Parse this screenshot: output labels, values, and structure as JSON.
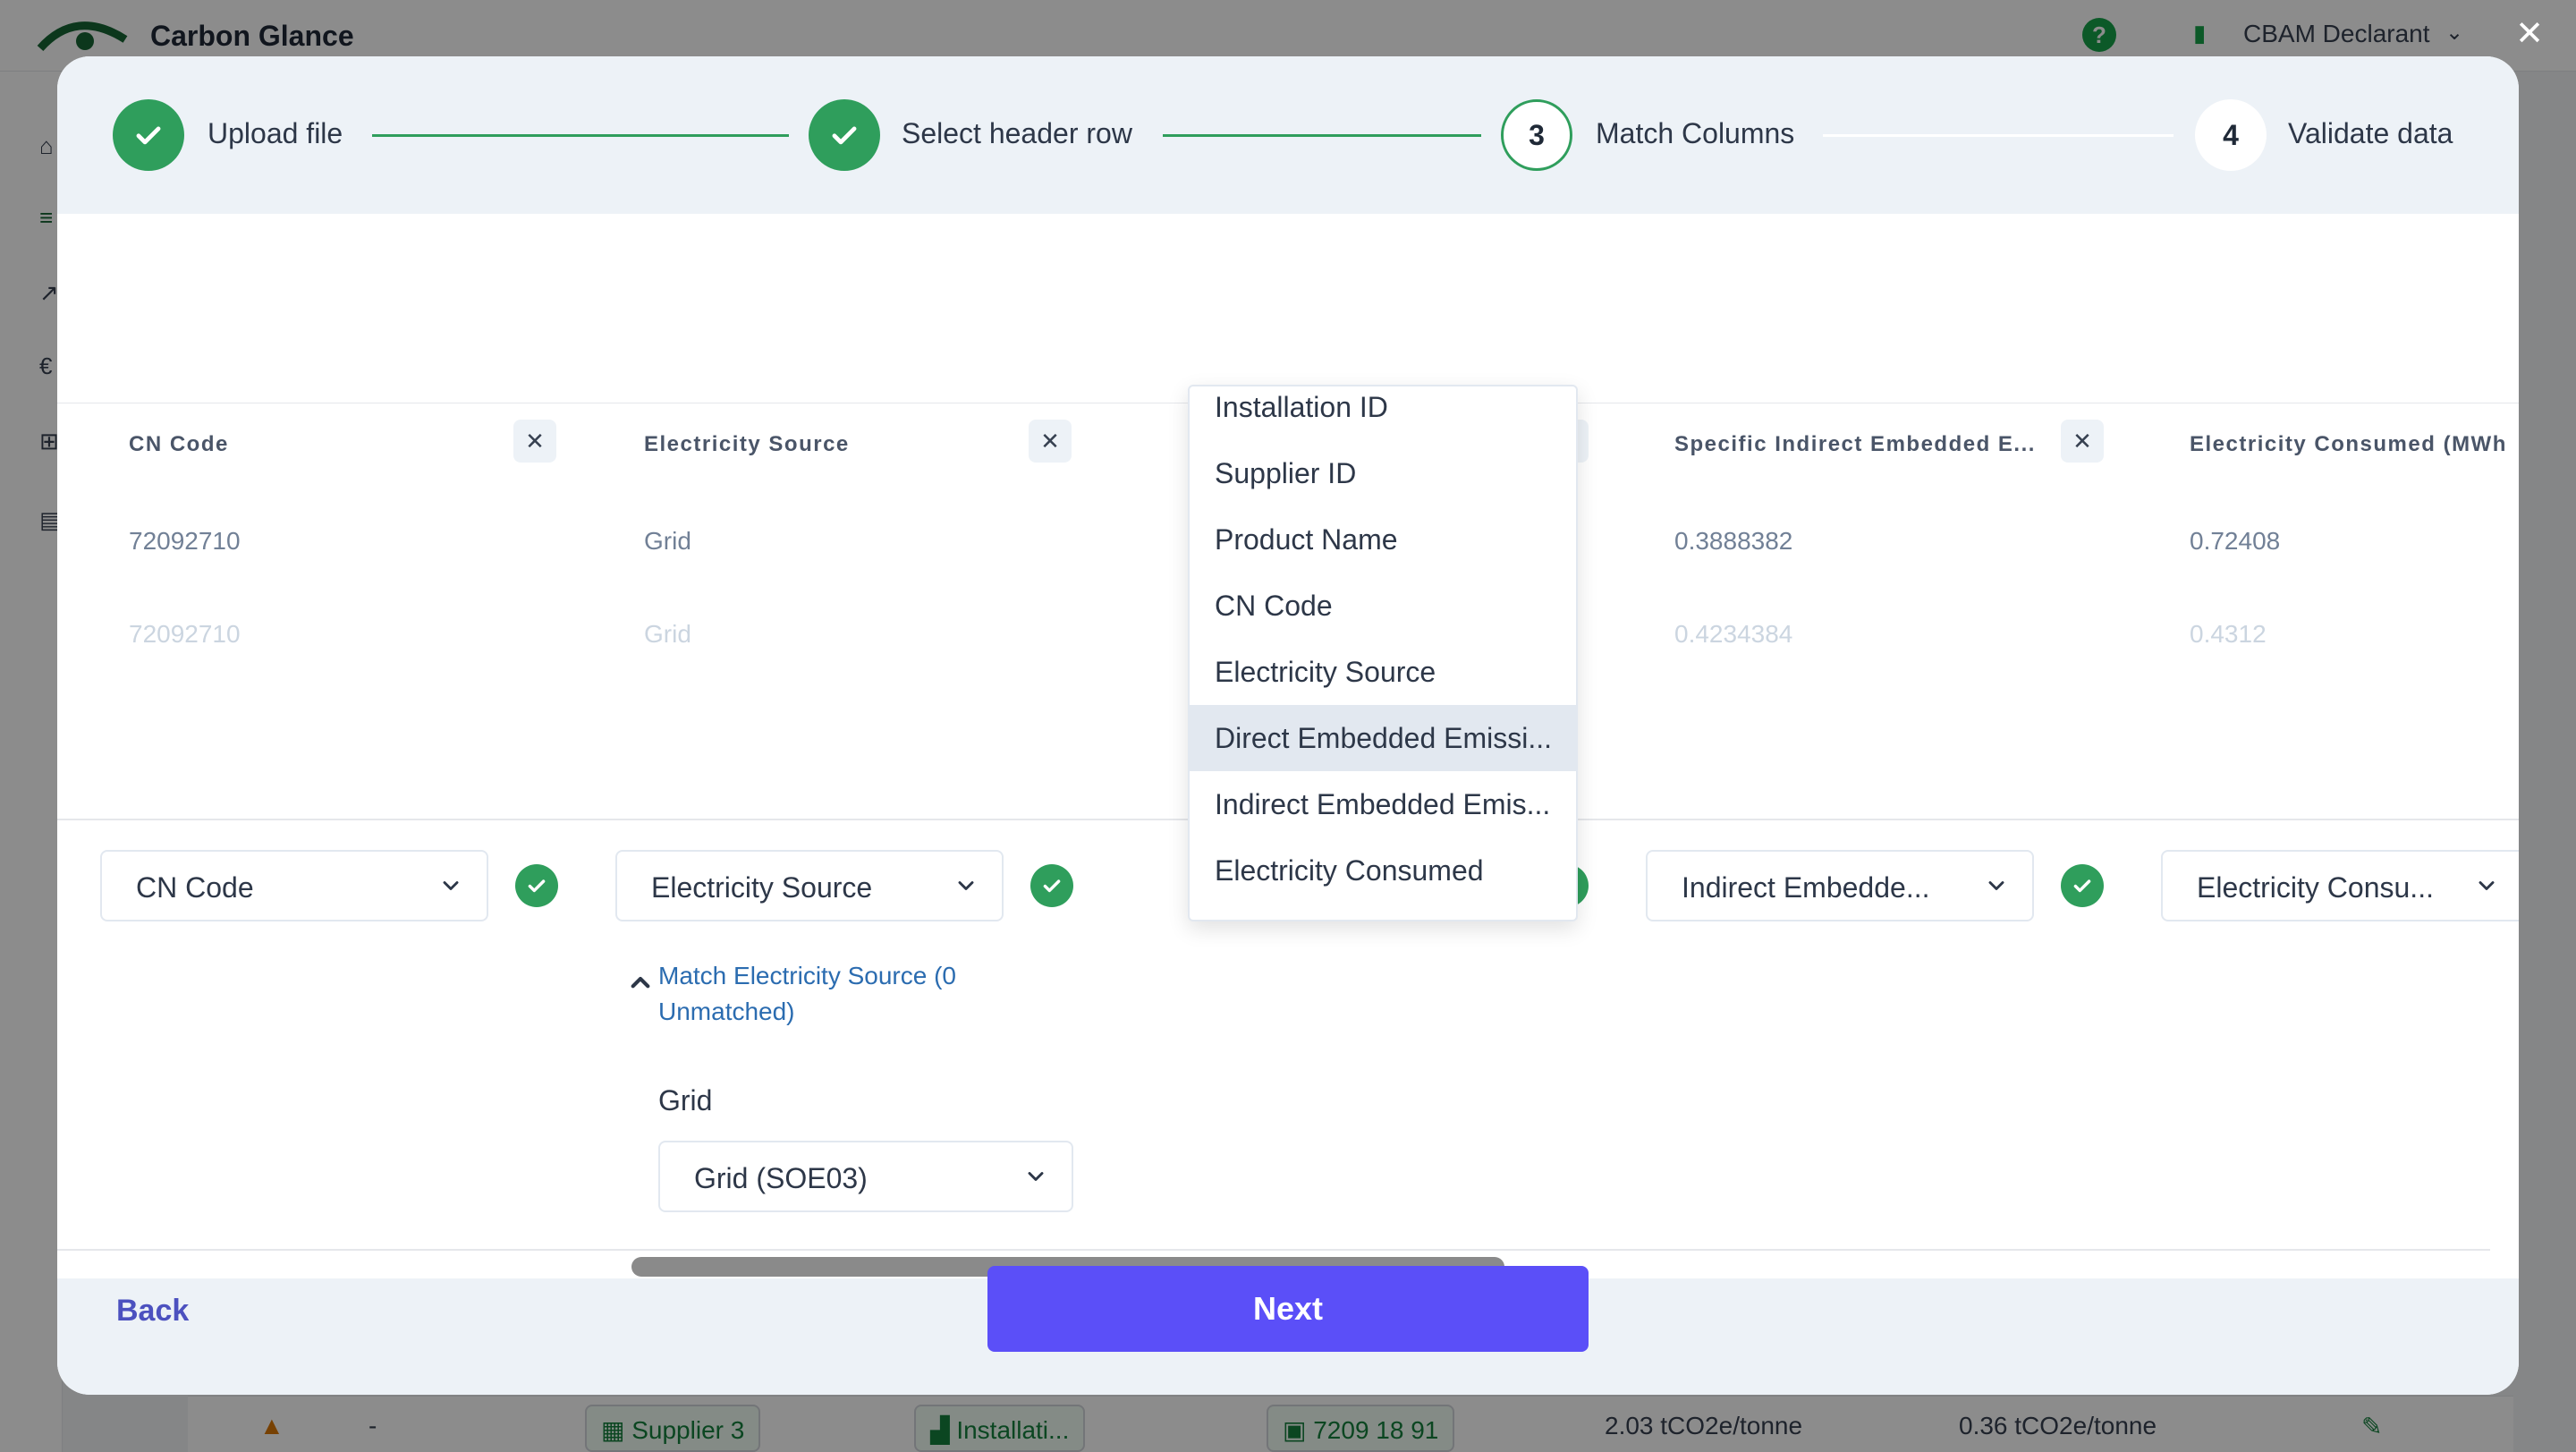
{
  "background": {
    "brand": "Carbon Glance",
    "help_label": "?",
    "user_label": "CBAM Declarant",
    "row": {
      "supplier": "Supplier 3",
      "installation": "Installati...",
      "dash": "-",
      "cn": "7209 18 91",
      "direct": "2.03 tCO2e/tonne",
      "indirect": "0.36 tCO2e/tonne"
    }
  },
  "stepper": {
    "steps": [
      {
        "number": "1",
        "label": "Upload file",
        "state": "done"
      },
      {
        "number": "2",
        "label": "Select header row",
        "state": "done"
      },
      {
        "number": "3",
        "label": "Match Columns",
        "state": "active"
      },
      {
        "number": "4",
        "label": "Validate data",
        "state": "todo"
      }
    ]
  },
  "columns": [
    {
      "header": "CN Code",
      "row1": "72092710",
      "row2": "72092710",
      "selected": "CN Code"
    },
    {
      "header": "Electricity Source",
      "row1": "Grid",
      "row2": "Grid",
      "selected": "Electricity Source"
    },
    {
      "header": "Specific Indirect Embedded E...",
      "row1": "0.3888382",
      "row2": "0.4234384",
      "selected": "Indirect Embedde..."
    },
    {
      "header": "Electricity Consumed (MWh",
      "row1": "0.72408",
      "row2": "0.4312",
      "selected": "Electricity Consu..."
    }
  ],
  "hidden_header_suffix": "..",
  "match": {
    "link_text": "Match Electricity Source (0 Unmatched)",
    "value_label": "Grid",
    "value_selected": "Grid (SOE03)"
  },
  "menu": {
    "items": [
      "Installation ID",
      "Supplier ID",
      "Product Name",
      "CN Code",
      "Electricity Source",
      "Direct Embedded Emissi...",
      "Indirect Embedded Emis...",
      "Electricity Consumed"
    ],
    "highlighted_index": 5
  },
  "footer": {
    "back_label": "Back",
    "next_label": "Next"
  },
  "colors": {
    "success": "#2f9e5c",
    "primary": "#5b4ff8",
    "link": "#2b6cb0"
  }
}
